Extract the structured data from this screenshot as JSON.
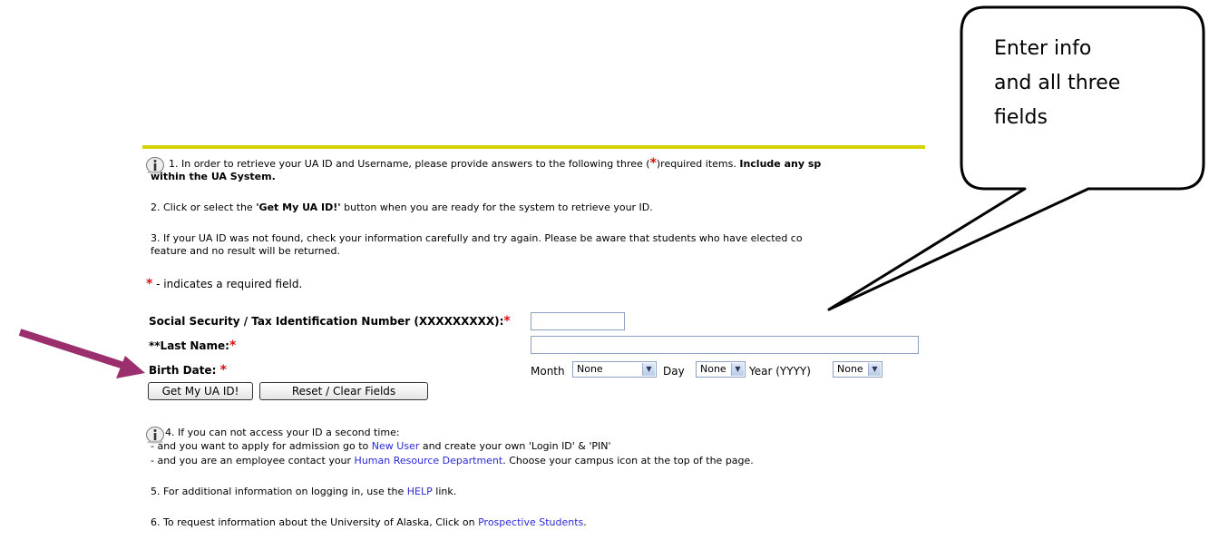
{
  "instructions": {
    "item1_main": "1. In order to retrieve your UA ID and Username, please provide answers to the following three (",
    "item1_req": "*",
    "item1_after": ")required items.",
    "item1_bold": "Include any sp",
    "item1_line2": "within the UA System.",
    "item2_pre": "2. Click or select the ",
    "item2_bold": "'Get My UA ID!'",
    "item2_post": " button when you are ready for the system to retrieve your ID.",
    "item3_line1": "3. If your UA ID was not found, check your information carefully and try again. Please be aware that students who have elected co",
    "item3_line2": "feature and no result will be returned."
  },
  "required_note": "- indicates a required field.",
  "form": {
    "ssn_label": "Social Security / Tax Identification Number (XXXXXXXXX):",
    "ssn_value": "",
    "lastname_label": "**Last Name:",
    "lastname_value": "",
    "birthdate_label": "Birth Date:",
    "month_label": "Month",
    "month_value": "None",
    "day_label": "Day",
    "day_value": "None",
    "year_label": "Year (YYYY)",
    "year_value": "None",
    "required_marker": "*"
  },
  "buttons": {
    "get_id": "Get My UA ID!",
    "reset": "Reset / Clear Fields"
  },
  "help": {
    "item4_line1": "4. If you can not access your ID a second time:",
    "item4_line2_pre": "- and you want to apply for admission go to ",
    "item4_line2_link": "New User",
    "item4_line2_post": " and create your own 'Login ID' & 'PIN'",
    "item4_line3_pre": "- and you are an employee contact your ",
    "item4_line3_link": "Human Resource Department",
    "item4_line3_post": ". Choose your campus icon at the top of the page.",
    "item5_pre": "5. For additional information on logging in, use the ",
    "item5_link": "HELP",
    "item5_post": " link.",
    "item6_pre": "6. To request information about the University of Alaska, Click on ",
    "item6_link": "Prospective Students",
    "item6_post": "."
  },
  "callout": {
    "line1": "Enter info",
    "line2": "and all three",
    "line3": "fields"
  },
  "colors": {
    "accent_bar": "#d6d200",
    "required": "#dd1111",
    "link": "#2a2ad6",
    "arrow": "#9b2f6e"
  },
  "icons": {
    "info": "info-icon",
    "arrow": "pointer-arrow",
    "callout": "speech-bubble"
  }
}
